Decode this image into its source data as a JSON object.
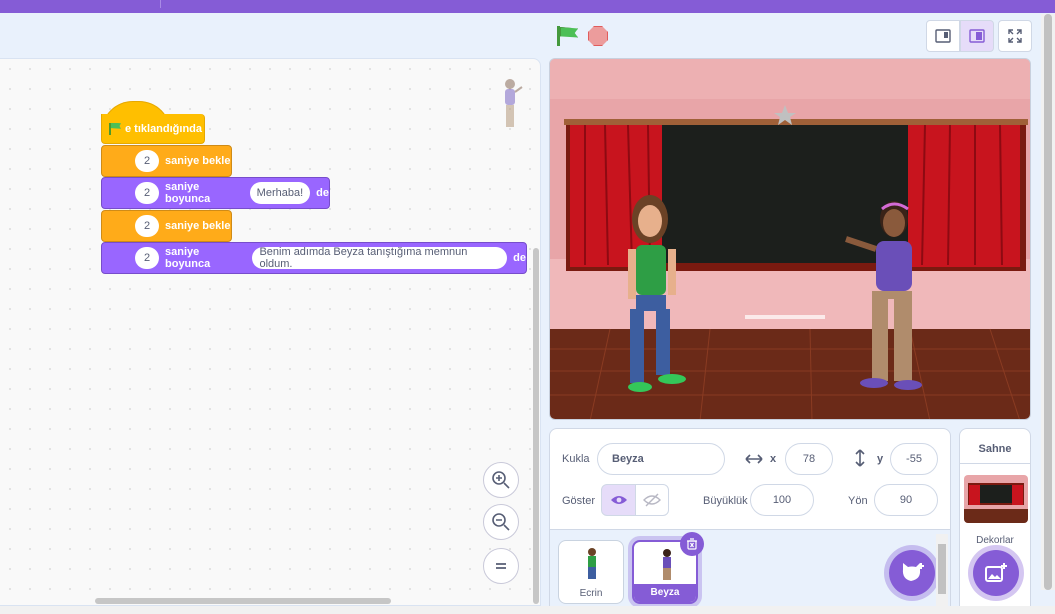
{
  "workspace": {
    "blocks": {
      "hat_label": "e tıklandığında",
      "wait1": {
        "num": "2",
        "label": "saniye bekle"
      },
      "say1": {
        "num": "2",
        "label": "saniye boyunca",
        "text": "Merhaba!",
        "suffix": "de"
      },
      "wait2": {
        "num": "2",
        "label": "saniye bekle"
      },
      "say2": {
        "num": "2",
        "label": "saniye boyunca",
        "text": "Benim adımda Beyza tanıştığıma memnun oldum.",
        "suffix": "de"
      }
    },
    "zoom_icons": [
      "zoom-in-icon",
      "zoom-out-icon",
      "zoom-reset-icon"
    ]
  },
  "stage_controls": {
    "icons": [
      "green-flag-icon",
      "stop-icon",
      "small-stage-icon",
      "large-stage-icon",
      "fullscreen-icon"
    ]
  },
  "sprite_info": {
    "sprite_label": "Kukla",
    "sprite_name": "Beyza",
    "x_label": "x",
    "x_value": "78",
    "y_label": "y",
    "y_value": "-55",
    "show_label": "Göster",
    "size_label": "Büyüklük",
    "size_value": "100",
    "direction_label": "Yön",
    "direction_value": "90"
  },
  "sprites": [
    {
      "name": "Ecrin",
      "selected": false
    },
    {
      "name": "Beyza",
      "selected": true
    }
  ],
  "stage_panel": {
    "title": "Sahne",
    "backdrops_label": "Dekorlar"
  },
  "colors": {
    "menu_bar": "#855cd6",
    "control": "#ffab19",
    "events": "#ffbf00",
    "looks": "#9966ff"
  }
}
